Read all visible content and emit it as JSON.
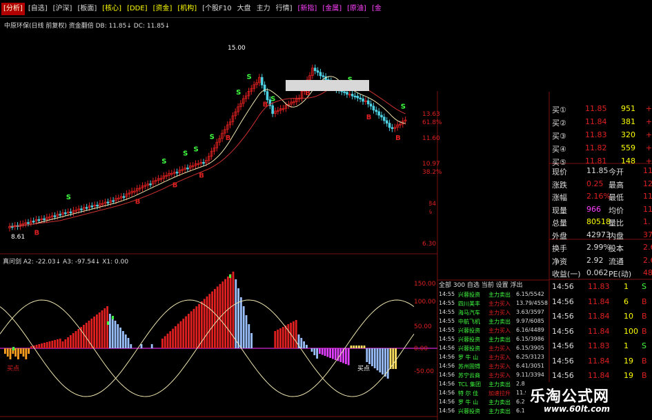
{
  "toolbar": {
    "items": [
      "[分析]",
      "[自选]",
      "[沪深]",
      "[板面]",
      "[核心]",
      "[DDE]",
      "[资金]",
      "[机构]",
      "[个股F10",
      "大盘",
      "主力",
      "行情]",
      "[新指]",
      "[金属]",
      "[原油]",
      "[金"
    ]
  },
  "chart_title": "中原环保(日线 前复权) 资金翻倍   DB: 11.85↓  DC: 11.85↓",
  "price_labels": {
    "high": "15.00",
    "range": "13.55-13.34",
    "low": "8.61",
    "axis": [
      "13.63",
      "61.8%",
      "11.60",
      "10.97",
      "38.2%",
      "6.84",
      "1%",
      "6.30"
    ]
  },
  "indicator_title": "真问剑  A2: -22.03↓  A3: -97.54↓  X1: 0.00",
  "indicator_axis": [
    "150.00",
    "100.00",
    "50.00",
    "0.00",
    "-50.00"
  ],
  "indicator_labels": {
    "left": "买点",
    "right": "买点"
  },
  "signal_letters": {
    "sell": "S",
    "buy": "B"
  },
  "quote_panel": {
    "bids": [
      {
        "label": "买①",
        "price": "11.85",
        "vol": "951",
        "chg": "+9"
      },
      {
        "label": "买②",
        "price": "11.84",
        "vol": "381",
        "chg": "+3"
      },
      {
        "label": "买③",
        "price": "11.83",
        "vol": "320",
        "chg": "+3"
      },
      {
        "label": "买④",
        "price": "11.82",
        "vol": "559",
        "chg": "+5"
      },
      {
        "label": "买⑤",
        "price": "11.81",
        "vol": "148",
        "chg": "+1"
      }
    ],
    "stats": [
      {
        "l1": "现价",
        "v1": "11.85",
        "l2": "今开",
        "v2": "11."
      },
      {
        "l1": "涨跌",
        "v1": "0.25",
        "l2": "最高",
        "v2": "12."
      },
      {
        "l1": "涨幅",
        "v1": "2.16%",
        "l2": "最低",
        "v2": "11."
      },
      {
        "l1": "现量",
        "v1": "966",
        "l2": "均价",
        "v2": "11."
      },
      {
        "l1": "总量",
        "v1": "80518",
        "l2": "量比",
        "v2": "1."
      },
      {
        "l1": "外盘",
        "v1": "42973",
        "l2": "内盘",
        "v2": "375"
      },
      {
        "l1": "换手",
        "v1": "2.99%",
        "l2": "股本",
        "v2": "2.69"
      },
      {
        "l1": "净资",
        "v1": "2.92",
        "l2": "流通",
        "v2": "2.69"
      },
      {
        "l1": "收益(一)",
        "v1": "0.062",
        "l2": "PE(动)",
        "v2": "48"
      }
    ],
    "ticks": [
      {
        "time": "14:56",
        "price": "11.83",
        "vol": "1",
        "flag": "S"
      },
      {
        "time": "14:56",
        "price": "11.84",
        "vol": "6",
        "flag": "B"
      },
      {
        "time": "14:56",
        "price": "11.84",
        "vol": "10",
        "flag": "B"
      },
      {
        "time": "14:56",
        "price": "11.84",
        "vol": "100",
        "flag": "B"
      },
      {
        "time": "14:56",
        "price": "11.83",
        "vol": "1",
        "flag": "S"
      },
      {
        "time": "14:56",
        "price": "11.84",
        "vol": "19",
        "flag": "B"
      },
      {
        "time": "14:56",
        "price": "11.84",
        "vol": "19",
        "flag": "B"
      },
      {
        "time": "14:56",
        "price": "11.84",
        "vol": "53",
        "flag": "S"
      }
    ]
  },
  "tick_list": {
    "tabs": "全部  300  自选  当前  设置  浮出",
    "rows": [
      {
        "time": "14:55",
        "name": "兴蓉投资",
        "action": "主力卖出",
        "val": "6.15/5542"
      },
      {
        "time": "14:55",
        "name": "四川美丰",
        "action": "主力买入",
        "val": "13.79/4558"
      },
      {
        "time": "14:55",
        "name": "海马汽车",
        "action": "主力买入",
        "val": "3.63/3597"
      },
      {
        "time": "14:55",
        "name": "中航飞机",
        "action": "主力卖出",
        "val": "9.97/6085"
      },
      {
        "time": "14:55",
        "name": "兴蓉投资",
        "action": "主力买入",
        "val": "6.16/4489"
      },
      {
        "time": "14:55",
        "name": "兴蓉投资",
        "action": "主力卖出",
        "val": "6.15/3986"
      },
      {
        "time": "14:56",
        "name": "兴蓉投资",
        "action": "主力买入",
        "val": "6.15/3905"
      },
      {
        "time": "14:56",
        "name": "罗 牛 山",
        "action": "主力买入",
        "val": "6.25/3123"
      },
      {
        "time": "14:56",
        "name": "苏州固锝",
        "action": "主力买入",
        "val": "6.41/3051"
      },
      {
        "time": "14:56",
        "name": "苏宁云商",
        "action": "主力买入",
        "val": "9.11/3394"
      },
      {
        "time": "14:56",
        "name": "TCL 集团",
        "action": "主力卖出",
        "val": "2.8"
      },
      {
        "time": "14:56",
        "name": "特 尔 佳",
        "action": "加速拉升",
        "val": "11.9"
      },
      {
        "time": "14:56",
        "name": "罗 牛 山",
        "action": "主力卖出",
        "val": "6.2"
      },
      {
        "time": "14:56",
        "name": "兴蓉投资",
        "action": "主力卖出",
        "val": "6.1"
      }
    ]
  },
  "watermark": {
    "cn": "乐淘公式网",
    "url": "www.60lt.com"
  },
  "colors": {
    "up": "#e02020",
    "down": "#4dd0e1",
    "ma_short": "#f0e6b0",
    "ma_long": "#d03030",
    "buy_bar": "#e02020",
    "sell_bar": "#9ac0ff",
    "neg_bar": "#e040ff",
    "yellow_bar": "#ffe060",
    "orange_bar": "#ffa020",
    "green_dot": "#40ff40"
  }
}
